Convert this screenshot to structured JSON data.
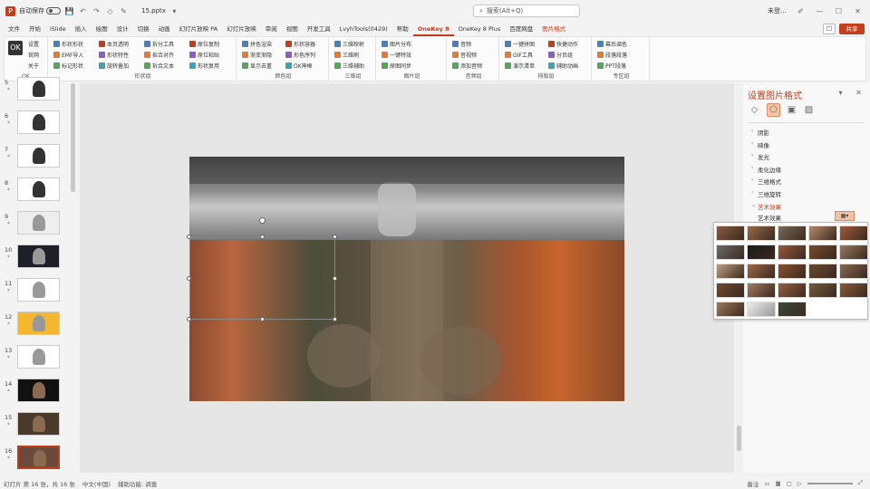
{
  "titlebar": {
    "autosave": "自动保存",
    "off": "关",
    "file": "15.pptx",
    "user": "毛毛",
    "wechat": "1",
    "account": "未登…"
  },
  "search": {
    "placeholder": "搜索(Alt+Q)"
  },
  "tabs": [
    "文件",
    "开始",
    "iSlide",
    "插入",
    "绘图",
    "设计",
    "切换",
    "动画",
    "幻灯片放映 PA",
    "幻灯片放映",
    "审阅",
    "视图",
    "开发工具",
    "LvyhTools(0429)",
    "帮助",
    "OneKey 8",
    "OneKey 8 Plus",
    "百度网盘",
    "图片格式"
  ],
  "share": "共享",
  "ribbon": {
    "g1": {
      "label": "OK",
      "items": [
        "设置",
        "官网",
        "关于"
      ]
    },
    "g2": {
      "items": [
        "形状形状",
        "EMF导入",
        "标记形状",
        "本页透明",
        "形状特性",
        "旋转叠加",
        "拆分工具",
        "拟合对齐",
        "拆合文本",
        "原位复制",
        "原位粘贴",
        "形状复用"
      ],
      "label": "形状组"
    },
    "g3": {
      "items": [
        "拼色渲染",
        "渐变渐隐",
        "显示去重",
        "形状容器",
        "形色序列",
        "OK神框"
      ],
      "label": "颜色组"
    },
    "g4": {
      "items": [
        "三维映射",
        "三维刷",
        "三维辅助"
      ],
      "label": "三维组"
    },
    "g5": {
      "items": [
        "图片分布",
        "一键特效",
        "原图同步"
      ],
      "label": "图片组"
    },
    "g6": {
      "items": [
        "音频",
        "音视频",
        "添加音频"
      ],
      "label": "音频组"
    },
    "g7": {
      "items": [
        "一键拼图",
        "GIF工具",
        "演示清单",
        "快捷动作",
        "分页组",
        "辅助动画"
      ],
      "label": "排版组"
    },
    "g8": {
      "items": [
        "幕后调色",
        "段落段落",
        "PPT段落"
      ],
      "label": "专区组"
    }
  },
  "slides": [
    {
      "n": "5"
    },
    {
      "n": "6"
    },
    {
      "n": "7"
    },
    {
      "n": "8"
    },
    {
      "n": "9"
    },
    {
      "n": "10"
    },
    {
      "n": "11"
    },
    {
      "n": "12"
    },
    {
      "n": "13"
    },
    {
      "n": "14"
    },
    {
      "n": "15"
    },
    {
      "n": "16"
    }
  ],
  "pane": {
    "title": "设置图片格式",
    "items": [
      "阴影",
      "映像",
      "发光",
      "柔化边缘",
      "三维格式",
      "三维旋转",
      "艺术效果"
    ],
    "artlabel": "艺术效果"
  },
  "status": {
    "slide": "幻灯片 第 16 张，共 16 张",
    "lang": "中文(中国)",
    "access": "辅助功能: 调查",
    "zoom": "备注"
  }
}
